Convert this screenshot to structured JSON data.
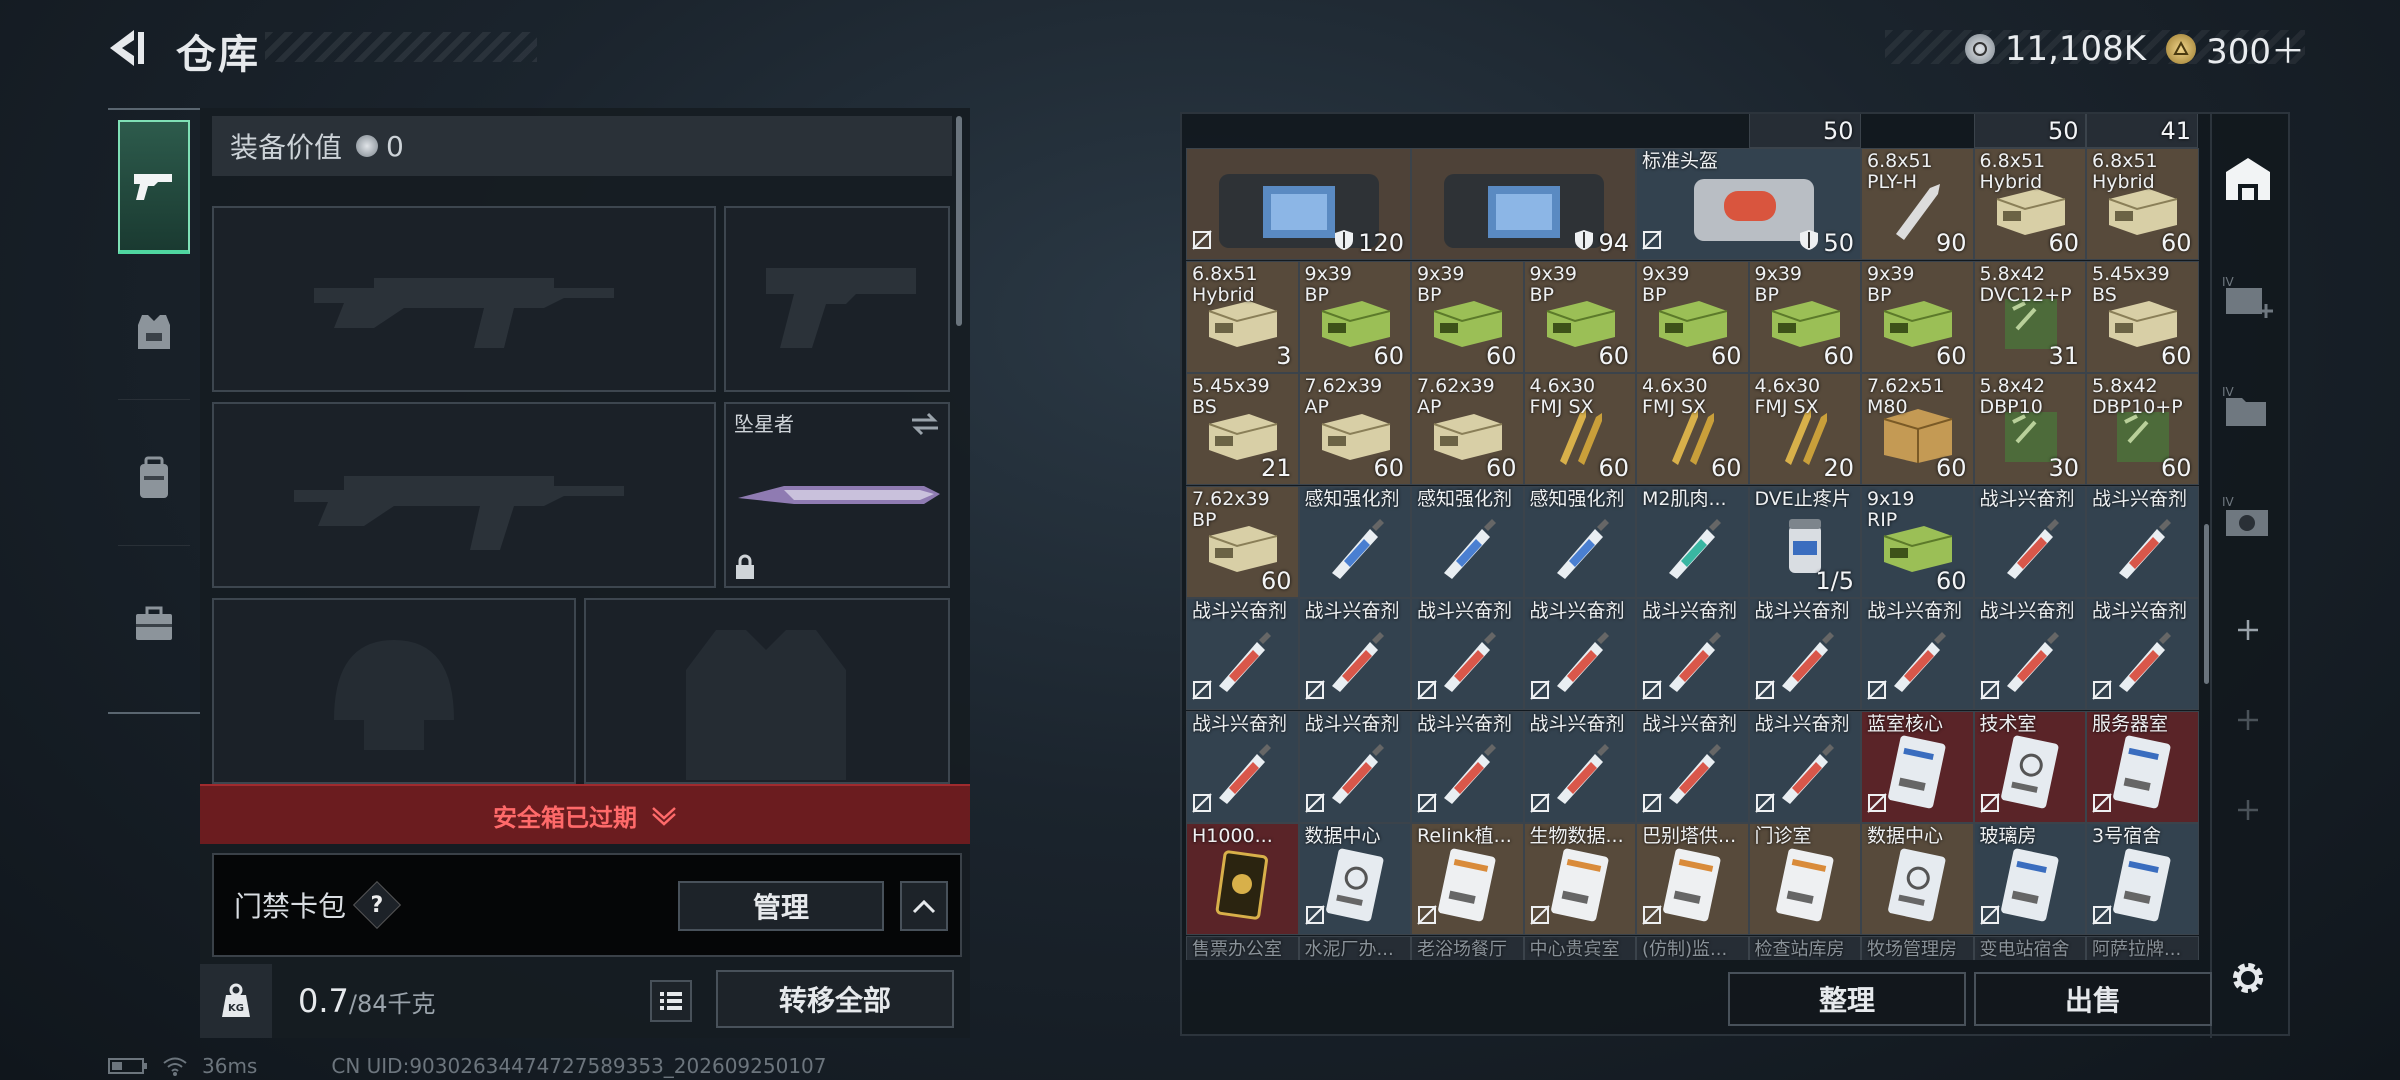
{
  "header": {
    "title": "仓库"
  },
  "currency": {
    "silver": "11,108K",
    "gold": "300＋"
  },
  "equipment": {
    "value_label": "装备价值",
    "value": "0",
    "melee_name": "坠星者",
    "safe_box_status": "安全箱已过期",
    "card_pack_label": "门禁卡包",
    "help": "?",
    "manage_label": "管理",
    "weight_value": "0.7",
    "weight_max": "/84千克",
    "transfer_all_label": "转移全部"
  },
  "status_bar": {
    "ping": "36ms",
    "uid": "CN UID:90302634474727589353_202609250107"
  },
  "storage": {
    "top_partial": [
      "50",
      "50",
      "41"
    ],
    "rows": [
      [
        {
          "name": "",
          "count": "120",
          "type": "bag",
          "bg": "bag",
          "shield": true,
          "lock": true,
          "span": 2
        },
        {
          "name": "",
          "count": "94",
          "type": "bag",
          "bg": "bag",
          "shield": true,
          "lock": false,
          "span": 2
        },
        {
          "name": "标准头盔",
          "count": "50",
          "type": "bag2",
          "bg": "blue",
          "shield": true,
          "lock": true,
          "span": 2
        },
        {
          "name": "6.8x51\nPLY-H",
          "count": "90",
          "type": "round",
          "bg": "ammo"
        },
        {
          "name": "6.8x51\nHybrid",
          "count": "60",
          "type": "ammo",
          "bg": "ammo"
        },
        {
          "name": "6.8x51\nHybrid",
          "count": "60",
          "type": "ammo",
          "bg": "ammo"
        }
      ],
      [
        {
          "name": "6.8x51\nHybrid",
          "count": "3",
          "type": "ammo",
          "bg": "ammo"
        },
        {
          "name": "9x39\nBP",
          "count": "60",
          "type": "green",
          "bg": "ammo"
        },
        {
          "name": "9x39\nBP",
          "count": "60",
          "type": "green",
          "bg": "ammo"
        },
        {
          "name": "9x39\nBP",
          "count": "60",
          "type": "green",
          "bg": "ammo"
        },
        {
          "name": "9x39\nBP",
          "count": "60",
          "type": "green",
          "bg": "ammo"
        },
        {
          "name": "9x39\nBP",
          "count": "60",
          "type": "green",
          "bg": "ammo"
        },
        {
          "name": "9x39\nBP",
          "count": "60",
          "type": "green",
          "bg": "ammo"
        },
        {
          "name": "5.8x42\nDVC12+P",
          "count": "31",
          "type": "greenbox",
          "bg": "ammo"
        },
        {
          "name": "5.45x39\nBS",
          "count": "60",
          "type": "ammo",
          "bg": "ammo"
        }
      ],
      [
        {
          "name": "5.45x39\nBS",
          "count": "21",
          "type": "ammo",
          "bg": "ammo"
        },
        {
          "name": "7.62x39\nAP",
          "count": "60",
          "type": "ammo",
          "bg": "ammo"
        },
        {
          "name": "7.62x39\nAP",
          "count": "60",
          "type": "ammo",
          "bg": "ammo"
        },
        {
          "name": "4.6x30\nFMJ SX",
          "count": "60",
          "type": "bullets",
          "bg": "ammo"
        },
        {
          "name": "4.6x30\nFMJ SX",
          "count": "60",
          "type": "bullets",
          "bg": "ammo"
        },
        {
          "name": "4.6x30\nFMJ SX",
          "count": "20",
          "type": "bullets",
          "bg": "ammo"
        },
        {
          "name": "7.62x51\nM80",
          "count": "60",
          "type": "crate",
          "bg": "ammo"
        },
        {
          "name": "5.8x42\nDBP10",
          "count": "30",
          "type": "greenbox",
          "bg": "ammo"
        },
        {
          "name": "5.8x42\nDBP10+P",
          "count": "60",
          "type": "greenbox",
          "bg": "ammo"
        }
      ],
      [
        {
          "name": "7.62x39\nBP",
          "count": "60",
          "type": "ammo",
          "bg": "ammo"
        },
        {
          "name": "感知强化剂",
          "count": "",
          "type": "syr-blue",
          "bg": "blue"
        },
        {
          "name": "感知强化剂",
          "count": "",
          "type": "syr-blue",
          "bg": "blue"
        },
        {
          "name": "感知强化剂",
          "count": "",
          "type": "syr-blue",
          "bg": "blue"
        },
        {
          "name": "M2肌肉...",
          "count": "",
          "type": "syr-teal",
          "bg": "blue"
        },
        {
          "name": "DVE止疼片",
          "count": "1/5",
          "type": "pills",
          "bg": "blue"
        },
        {
          "name": "9x19\nRIP",
          "count": "60",
          "type": "green",
          "bg": "blue"
        },
        {
          "name": "战斗兴奋剂",
          "count": "",
          "type": "syr-red",
          "bg": "blue"
        },
        {
          "name": "战斗兴奋剂",
          "count": "",
          "type": "syr-red",
          "bg": "blue"
        }
      ],
      [
        {
          "name": "战斗兴奋剂",
          "count": "",
          "type": "syr-red",
          "bg": "blue",
          "lock": true
        },
        {
          "name": "战斗兴奋剂",
          "count": "",
          "type": "syr-red",
          "bg": "blue",
          "lock": true
        },
        {
          "name": "战斗兴奋剂",
          "count": "",
          "type": "syr-red",
          "bg": "blue",
          "lock": true
        },
        {
          "name": "战斗兴奋剂",
          "count": "",
          "type": "syr-red",
          "bg": "blue",
          "lock": true
        },
        {
          "name": "战斗兴奋剂",
          "count": "",
          "type": "syr-red",
          "bg": "blue",
          "lock": true
        },
        {
          "name": "战斗兴奋剂",
          "count": "",
          "type": "syr-red",
          "bg": "blue",
          "lock": true
        },
        {
          "name": "战斗兴奋剂",
          "count": "",
          "type": "syr-red",
          "bg": "blue",
          "lock": true
        },
        {
          "name": "战斗兴奋剂",
          "count": "",
          "type": "syr-red",
          "bg": "blue",
          "lock": true
        },
        {
          "name": "战斗兴奋剂",
          "count": "",
          "type": "syr-red",
          "bg": "blue",
          "lock": true
        }
      ],
      [
        {
          "name": "战斗兴奋剂",
          "count": "",
          "type": "syr-red",
          "bg": "blue",
          "lock": true
        },
        {
          "name": "战斗兴奋剂",
          "count": "",
          "type": "syr-red",
          "bg": "blue",
          "lock": true
        },
        {
          "name": "战斗兴奋剂",
          "count": "",
          "type": "syr-red",
          "bg": "blue",
          "lock": true
        },
        {
          "name": "战斗兴奋剂",
          "count": "",
          "type": "syr-red",
          "bg": "blue",
          "lock": true
        },
        {
          "name": "战斗兴奋剂",
          "count": "",
          "type": "syr-red",
          "bg": "blue",
          "lock": true
        },
        {
          "name": "战斗兴奋剂",
          "count": "",
          "type": "syr-red",
          "bg": "blue",
          "lock": true
        },
        {
          "name": "蓝室核心",
          "count": "",
          "type": "card-blue",
          "bg": "red",
          "lock": true
        },
        {
          "name": "技术室",
          "count": "",
          "type": "card-gray",
          "bg": "red",
          "lock": true
        },
        {
          "name": "服务器室",
          "count": "",
          "type": "card-blue",
          "bg": "red",
          "lock": true
        }
      ],
      [
        {
          "name": "H1000...",
          "count": "",
          "type": "card-gold",
          "bg": "red"
        },
        {
          "name": "数据中心",
          "count": "",
          "type": "card-gray",
          "bg": "blue",
          "lock": true
        },
        {
          "name": "Relink植...",
          "count": "",
          "type": "card-orange",
          "bg": "ammo",
          "lock": true
        },
        {
          "name": "生物数据...",
          "count": "",
          "type": "card-orange",
          "bg": "ammo",
          "lock": true
        },
        {
          "name": "巴别塔供...",
          "count": "",
          "type": "card-orange",
          "bg": "ammo",
          "lock": true
        },
        {
          "name": "门诊室",
          "count": "",
          "type": "card-orange",
          "bg": "ammo"
        },
        {
          "name": "数据中心",
          "count": "",
          "type": "card-gray",
          "bg": "ammo"
        },
        {
          "name": "玻璃房",
          "count": "",
          "type": "card-blue",
          "bg": "blue",
          "lock": true
        },
        {
          "name": "3号宿舍",
          "count": "",
          "type": "card-blue",
          "bg": "blue",
          "lock": true
        }
      ],
      [
        {
          "name": "售票办公室"
        },
        {
          "name": "水泥厂办..."
        },
        {
          "name": "老浴场餐厅"
        },
        {
          "name": "中心贵宾室"
        },
        {
          "name": "(仿制)监..."
        },
        {
          "name": "检查站库房"
        },
        {
          "name": "牧场管理房"
        },
        {
          "name": "变电站宿舍"
        },
        {
          "name": "阿萨拉牌..."
        }
      ]
    ],
    "sort_label": "整理",
    "sell_label": "出售"
  },
  "side_icons": [
    "stash-icon",
    "add-container-icon",
    "folder-container-icon",
    "camera-container-icon",
    "plus-icon",
    "plus-icon",
    "plus-icon",
    "settings-icon"
  ],
  "colors": {
    "accent": "#4fd6a0",
    "warning": "#ff6a6a",
    "ammo_bg": "#574a3b",
    "blue_bg": "#33424f",
    "red_bg": "#5a2428"
  }
}
